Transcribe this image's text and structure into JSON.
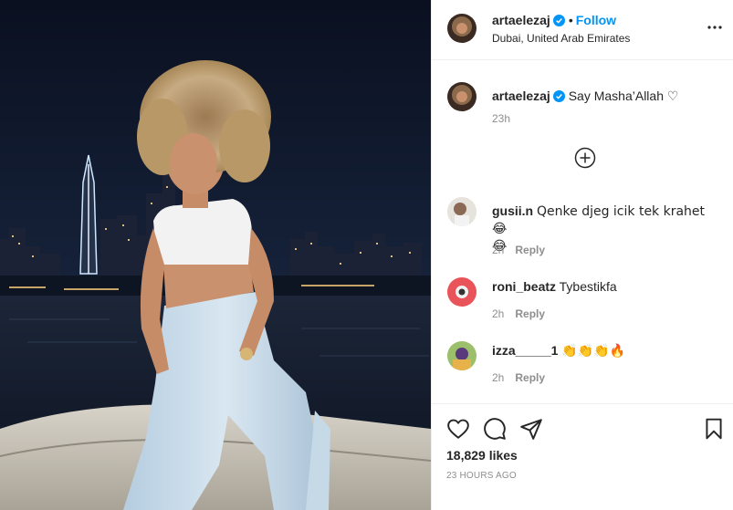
{
  "post": {
    "author": "artaelezaj",
    "follow_label": "Follow",
    "location": "Dubai, United Arab Emirates",
    "menu_icon": "more-icon"
  },
  "caption": {
    "author": "artaelezaj",
    "text": "Say Masha’Allah ♡",
    "time": "23h"
  },
  "comments": [
    {
      "user": "gusii.n",
      "text": "Qenke djeg icik tek krahet 😂",
      "text2": "😂",
      "time": "2h",
      "reply": "Reply"
    },
    {
      "user": "roni_beatz",
      "text": "Tybestikfa",
      "time": "2h",
      "reply": "Reply"
    },
    {
      "user": "izza_____1",
      "text": "👏👏👏🔥",
      "time": "2h",
      "reply": "Reply"
    }
  ],
  "footer": {
    "likes": "18,829 likes",
    "timestamp": "23 HOURS AGO"
  },
  "colors": {
    "accent": "#0095f6",
    "muted": "#8e8e8e",
    "text": "#262626",
    "border": "#efefef"
  }
}
